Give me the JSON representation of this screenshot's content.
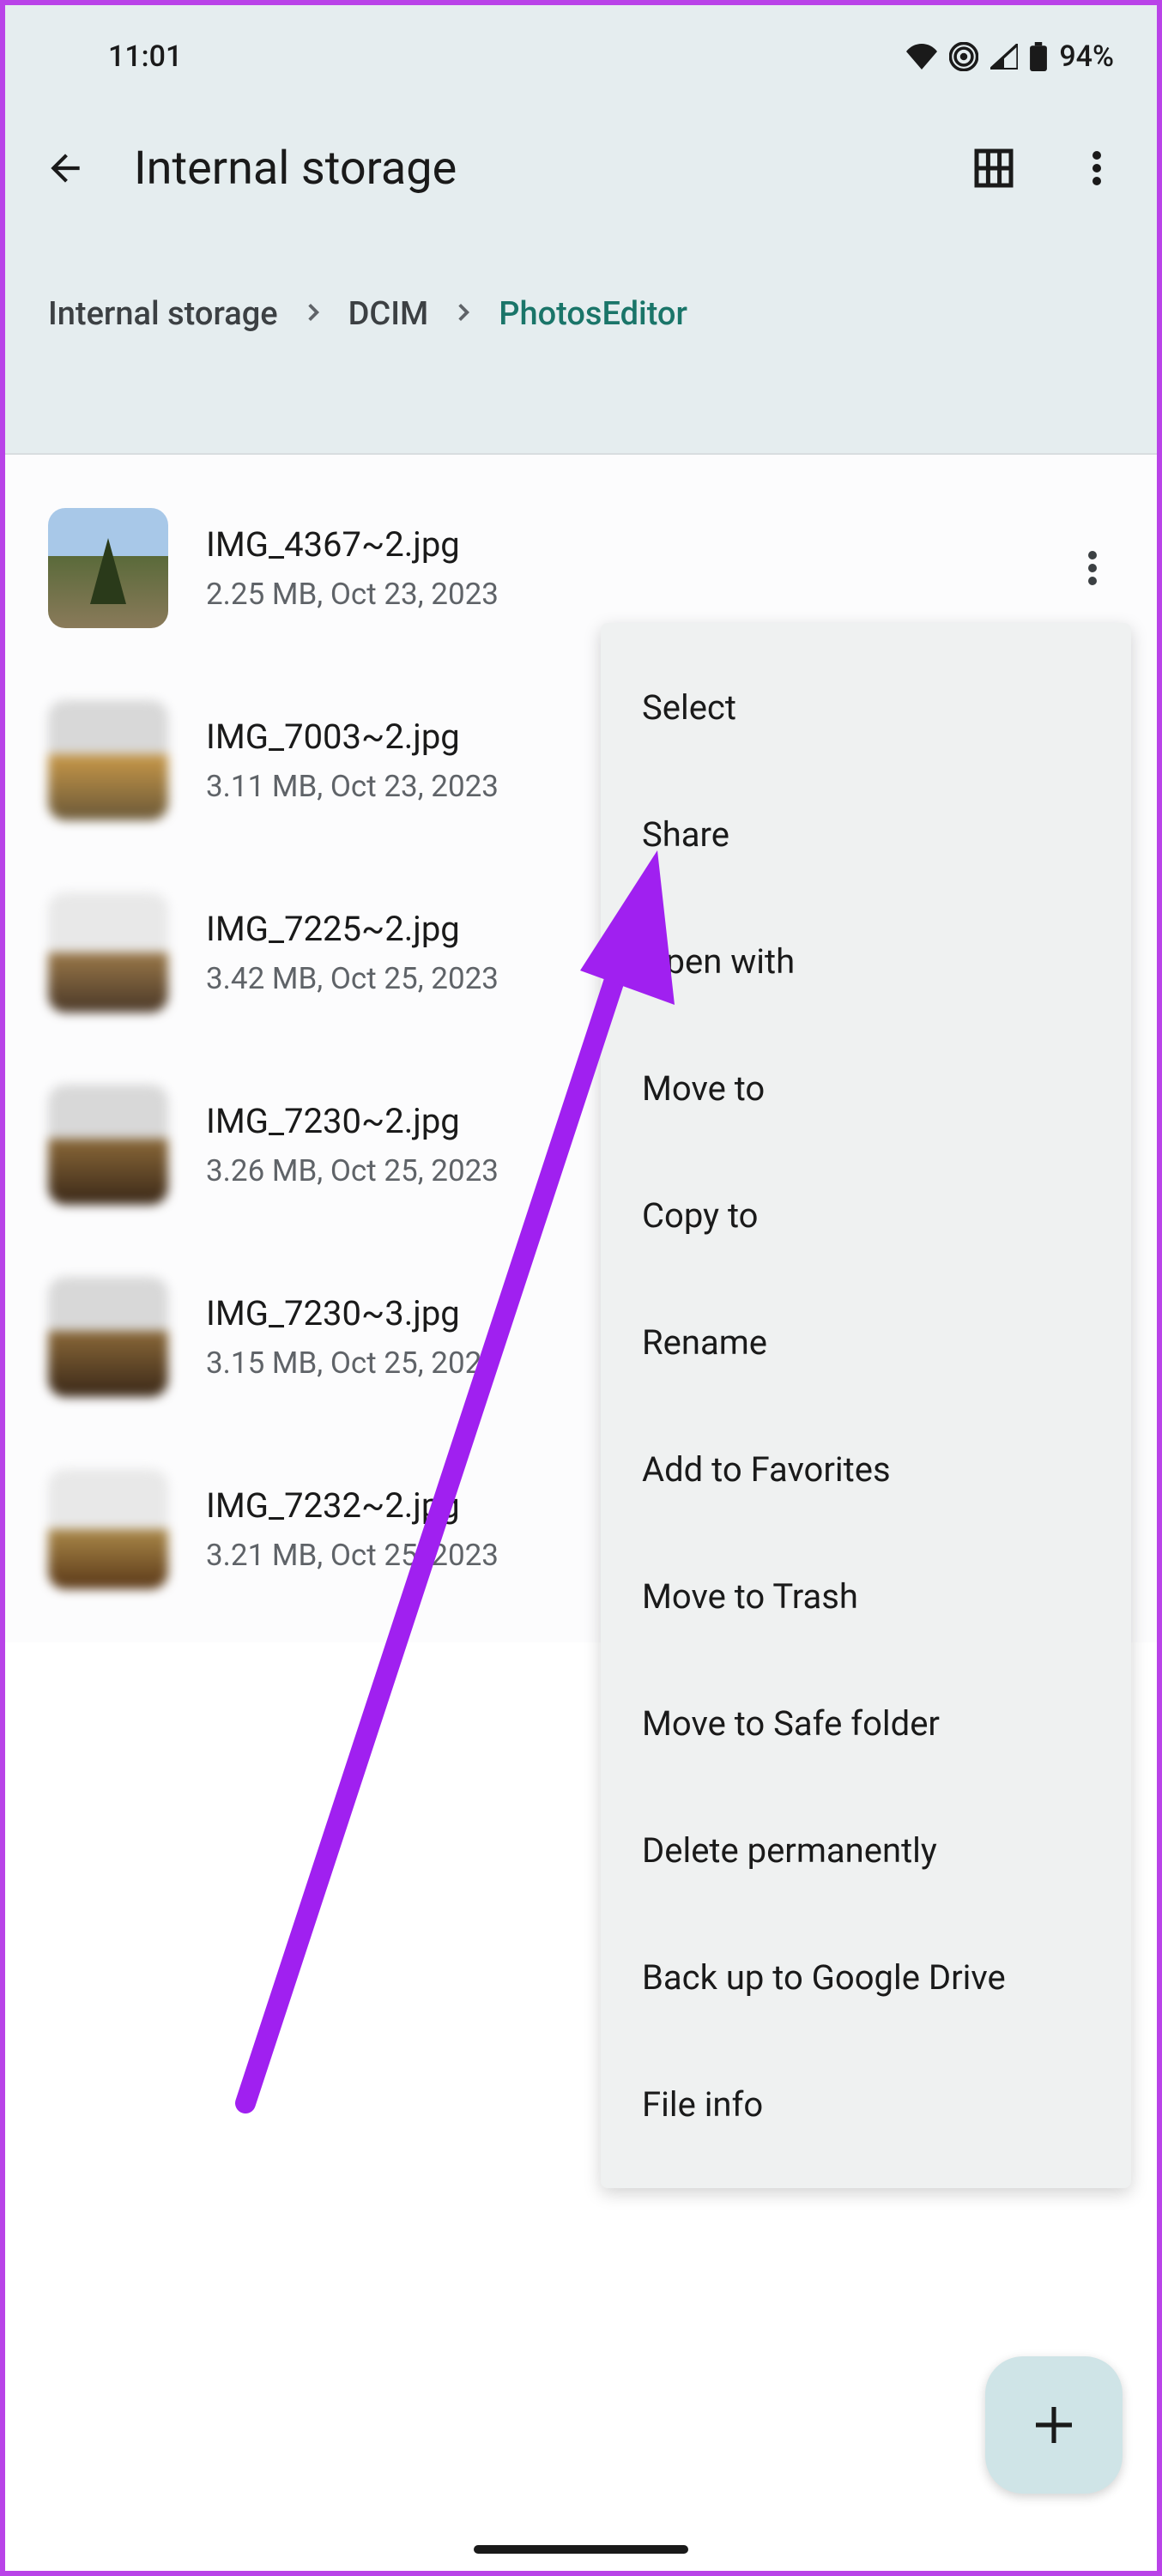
{
  "status": {
    "time": "11:01",
    "battery_pct": "94%"
  },
  "toolbar": {
    "title": "Internal storage"
  },
  "breadcrumb": [
    {
      "label": "Internal storage",
      "active": false
    },
    {
      "label": "DCIM",
      "active": false
    },
    {
      "label": "PhotosEditor",
      "active": true
    }
  ],
  "files": [
    {
      "name": "IMG_4367~2.jpg",
      "meta": "2.25 MB, Oct 23, 2023"
    },
    {
      "name": "IMG_7003~2.jpg",
      "meta": "3.11 MB, Oct 23, 2023"
    },
    {
      "name": "IMG_7225~2.jpg",
      "meta": "3.42 MB, Oct 25, 2023"
    },
    {
      "name": "IMG_7230~2.jpg",
      "meta": "3.26 MB, Oct 25, 2023"
    },
    {
      "name": "IMG_7230~3.jpg",
      "meta": "3.15 MB, Oct 25, 2023"
    },
    {
      "name": "IMG_7232~2.jpg",
      "meta": "3.21 MB, Oct 25, 2023"
    }
  ],
  "menu": [
    "Select",
    "Share",
    "Open with",
    "Move to",
    "Copy to",
    "Rename",
    "Add to Favorites",
    "Move to Trash",
    "Move to Safe folder",
    "Delete permanently",
    "Back up to Google Drive",
    "File info"
  ]
}
